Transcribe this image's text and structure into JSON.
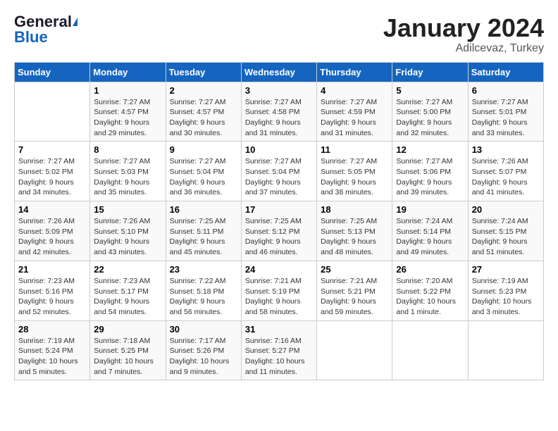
{
  "logo": {
    "general": "General",
    "blue": "Blue"
  },
  "title": {
    "month": "January 2024",
    "location": "Adilcevaz, Turkey"
  },
  "headers": [
    "Sunday",
    "Monday",
    "Tuesday",
    "Wednesday",
    "Thursday",
    "Friday",
    "Saturday"
  ],
  "weeks": [
    [
      {
        "day": "",
        "sunrise": "",
        "sunset": "",
        "daylight": ""
      },
      {
        "day": "1",
        "sunrise": "Sunrise: 7:27 AM",
        "sunset": "Sunset: 4:57 PM",
        "daylight": "Daylight: 9 hours and 29 minutes."
      },
      {
        "day": "2",
        "sunrise": "Sunrise: 7:27 AM",
        "sunset": "Sunset: 4:57 PM",
        "daylight": "Daylight: 9 hours and 30 minutes."
      },
      {
        "day": "3",
        "sunrise": "Sunrise: 7:27 AM",
        "sunset": "Sunset: 4:58 PM",
        "daylight": "Daylight: 9 hours and 31 minutes."
      },
      {
        "day": "4",
        "sunrise": "Sunrise: 7:27 AM",
        "sunset": "Sunset: 4:59 PM",
        "daylight": "Daylight: 9 hours and 31 minutes."
      },
      {
        "day": "5",
        "sunrise": "Sunrise: 7:27 AM",
        "sunset": "Sunset: 5:00 PM",
        "daylight": "Daylight: 9 hours and 32 minutes."
      },
      {
        "day": "6",
        "sunrise": "Sunrise: 7:27 AM",
        "sunset": "Sunset: 5:01 PM",
        "daylight": "Daylight: 9 hours and 33 minutes."
      }
    ],
    [
      {
        "day": "7",
        "sunrise": "Sunrise: 7:27 AM",
        "sunset": "Sunset: 5:02 PM",
        "daylight": "Daylight: 9 hours and 34 minutes."
      },
      {
        "day": "8",
        "sunrise": "Sunrise: 7:27 AM",
        "sunset": "Sunset: 5:03 PM",
        "daylight": "Daylight: 9 hours and 35 minutes."
      },
      {
        "day": "9",
        "sunrise": "Sunrise: 7:27 AM",
        "sunset": "Sunset: 5:04 PM",
        "daylight": "Daylight: 9 hours and 36 minutes."
      },
      {
        "day": "10",
        "sunrise": "Sunrise: 7:27 AM",
        "sunset": "Sunset: 5:04 PM",
        "daylight": "Daylight: 9 hours and 37 minutes."
      },
      {
        "day": "11",
        "sunrise": "Sunrise: 7:27 AM",
        "sunset": "Sunset: 5:05 PM",
        "daylight": "Daylight: 9 hours and 38 minutes."
      },
      {
        "day": "12",
        "sunrise": "Sunrise: 7:27 AM",
        "sunset": "Sunset: 5:06 PM",
        "daylight": "Daylight: 9 hours and 39 minutes."
      },
      {
        "day": "13",
        "sunrise": "Sunrise: 7:26 AM",
        "sunset": "Sunset: 5:07 PM",
        "daylight": "Daylight: 9 hours and 41 minutes."
      }
    ],
    [
      {
        "day": "14",
        "sunrise": "Sunrise: 7:26 AM",
        "sunset": "Sunset: 5:09 PM",
        "daylight": "Daylight: 9 hours and 42 minutes."
      },
      {
        "day": "15",
        "sunrise": "Sunrise: 7:26 AM",
        "sunset": "Sunset: 5:10 PM",
        "daylight": "Daylight: 9 hours and 43 minutes."
      },
      {
        "day": "16",
        "sunrise": "Sunrise: 7:25 AM",
        "sunset": "Sunset: 5:11 PM",
        "daylight": "Daylight: 9 hours and 45 minutes."
      },
      {
        "day": "17",
        "sunrise": "Sunrise: 7:25 AM",
        "sunset": "Sunset: 5:12 PM",
        "daylight": "Daylight: 9 hours and 46 minutes."
      },
      {
        "day": "18",
        "sunrise": "Sunrise: 7:25 AM",
        "sunset": "Sunset: 5:13 PM",
        "daylight": "Daylight: 9 hours and 48 minutes."
      },
      {
        "day": "19",
        "sunrise": "Sunrise: 7:24 AM",
        "sunset": "Sunset: 5:14 PM",
        "daylight": "Daylight: 9 hours and 49 minutes."
      },
      {
        "day": "20",
        "sunrise": "Sunrise: 7:24 AM",
        "sunset": "Sunset: 5:15 PM",
        "daylight": "Daylight: 9 hours and 51 minutes."
      }
    ],
    [
      {
        "day": "21",
        "sunrise": "Sunrise: 7:23 AM",
        "sunset": "Sunset: 5:16 PM",
        "daylight": "Daylight: 9 hours and 52 minutes."
      },
      {
        "day": "22",
        "sunrise": "Sunrise: 7:23 AM",
        "sunset": "Sunset: 5:17 PM",
        "daylight": "Daylight: 9 hours and 54 minutes."
      },
      {
        "day": "23",
        "sunrise": "Sunrise: 7:22 AM",
        "sunset": "Sunset: 5:18 PM",
        "daylight": "Daylight: 9 hours and 56 minutes."
      },
      {
        "day": "24",
        "sunrise": "Sunrise: 7:21 AM",
        "sunset": "Sunset: 5:19 PM",
        "daylight": "Daylight: 9 hours and 58 minutes."
      },
      {
        "day": "25",
        "sunrise": "Sunrise: 7:21 AM",
        "sunset": "Sunset: 5:21 PM",
        "daylight": "Daylight: 9 hours and 59 minutes."
      },
      {
        "day": "26",
        "sunrise": "Sunrise: 7:20 AM",
        "sunset": "Sunset: 5:22 PM",
        "daylight": "Daylight: 10 hours and 1 minute."
      },
      {
        "day": "27",
        "sunrise": "Sunrise: 7:19 AM",
        "sunset": "Sunset: 5:23 PM",
        "daylight": "Daylight: 10 hours and 3 minutes."
      }
    ],
    [
      {
        "day": "28",
        "sunrise": "Sunrise: 7:19 AM",
        "sunset": "Sunset: 5:24 PM",
        "daylight": "Daylight: 10 hours and 5 minutes."
      },
      {
        "day": "29",
        "sunrise": "Sunrise: 7:18 AM",
        "sunset": "Sunset: 5:25 PM",
        "daylight": "Daylight: 10 hours and 7 minutes."
      },
      {
        "day": "30",
        "sunrise": "Sunrise: 7:17 AM",
        "sunset": "Sunset: 5:26 PM",
        "daylight": "Daylight: 10 hours and 9 minutes."
      },
      {
        "day": "31",
        "sunrise": "Sunrise: 7:16 AM",
        "sunset": "Sunset: 5:27 PM",
        "daylight": "Daylight: 10 hours and 11 minutes."
      },
      {
        "day": "",
        "sunrise": "",
        "sunset": "",
        "daylight": ""
      },
      {
        "day": "",
        "sunrise": "",
        "sunset": "",
        "daylight": ""
      },
      {
        "day": "",
        "sunrise": "",
        "sunset": "",
        "daylight": ""
      }
    ]
  ]
}
